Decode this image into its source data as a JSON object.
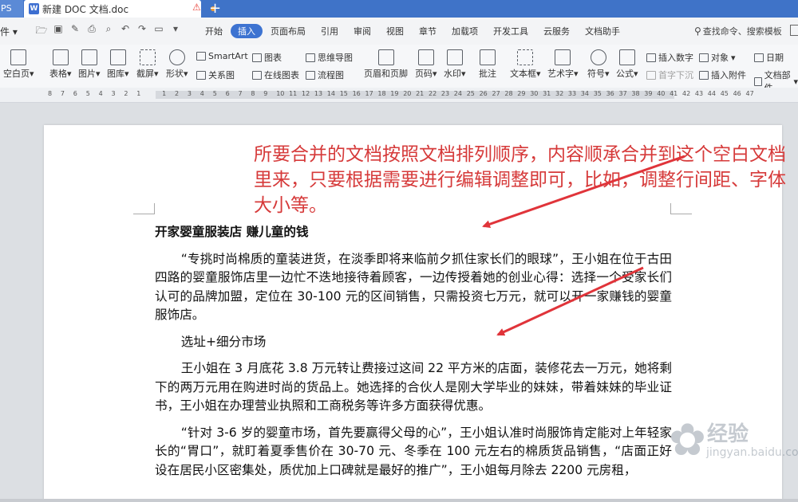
{
  "titlebar": {
    "app_tab_label": "PS",
    "doc_tab": {
      "icon_letter": "W",
      "title": "新建 DOC 文档.doc",
      "warn_glyph": "⚠"
    },
    "new_tab_glyph": "+"
  },
  "menubar": {
    "file_label": "件 ▾",
    "tabs": [
      "开始",
      "插入",
      "页面布局",
      "引用",
      "审阅",
      "视图",
      "章节",
      "加载项",
      "开发工具",
      "云服务",
      "文档助手"
    ],
    "active_tab": "插入",
    "search_text": "查找命令、搜索模板"
  },
  "ribbon": {
    "blank_page": "空白页",
    "table": "表格",
    "picture": "图片",
    "gallery": "图库",
    "screenshot": "截屏",
    "shape": "形状",
    "smartart": "SmartArt",
    "chart": "图表",
    "mindmap": "思维导图",
    "relation": "关系图",
    "online_chart": "在线图表",
    "flowchart": "流程图",
    "header_footer": "页眉和页脚",
    "page_number": "页码",
    "watermark": "水印",
    "comment": "批注",
    "textbox": "文本框",
    "wordart": "艺术字",
    "symbol": "符号",
    "formula": "公式",
    "insert_number": "插入数字",
    "object": "对象",
    "date": "日期",
    "dropcap": "首字下沉",
    "attachment": "插入附件",
    "doc_parts": "文档部件"
  },
  "ruler": {
    "numbers": [
      "8",
      "7",
      "6",
      "5",
      "4",
      "3",
      "2",
      "1",
      "",
      "1",
      "2",
      "3",
      "4",
      "5",
      "6",
      "7",
      "8",
      "9",
      "10",
      "11",
      "12",
      "13",
      "14",
      "15",
      "16",
      "17",
      "18",
      "19",
      "20",
      "21",
      "22",
      "23",
      "24",
      "25",
      "26",
      "27",
      "28",
      "29",
      "30",
      "31",
      "32",
      "33",
      "34",
      "35",
      "36",
      "37",
      "38",
      "39",
      "40",
      "41",
      "42",
      "43",
      "44",
      "45",
      "46",
      "47"
    ]
  },
  "annotation": {
    "text": "所要合并的文档按照文档排列顺序，内容顺承合并到这个空白文档里来，只要根据需要进行编辑调整即可，比如，调整行间距、字体大小等。",
    "color": "#d63a3a"
  },
  "document": {
    "heading": "开家婴童服装店 赚儿童的钱",
    "paragraphs": [
      "“专挑时尚棉质的童装进货，在淡季即将来临前夕抓住家长们的眼球”，王小姐在位于古田四路的婴童服饰店里一边忙不迭地接待着顾客，一边传授着她的创业心得：选择一个受家长们认可的品牌加盟，定位在 30-100 元的区间销售，只需投资七万元，就可以开一家赚钱的婴童服饰店。",
      "选址+细分市场",
      "王小姐在 3 月底花 3.8 万元转让费接过这间 22 平方米的店面，装修花去一万元，她将剩下的两万元用在购进时尚的货品上。她选择的合伙人是刚大学毕业的妹妹，带着妹妹的毕业证书，王小姐在办理营业执照和工商税务等许多方面获得优惠。",
      "“针对 3-6 岁的婴童市场，首先要赢得父母的心”，王小姐认准时尚服饰肯定能对上年轻家长的“胃口”，就盯着夏季售价在 30-70 元、冬季在 100 元左右的棉质货品销售，“店面正好设在居民小区密集处，质优加上口碑就是最好的推广”，王小姐每月除去 2200 元房租，"
    ]
  },
  "watermark": {
    "brand": "经验",
    "url": "jingyan.baidu.com"
  }
}
